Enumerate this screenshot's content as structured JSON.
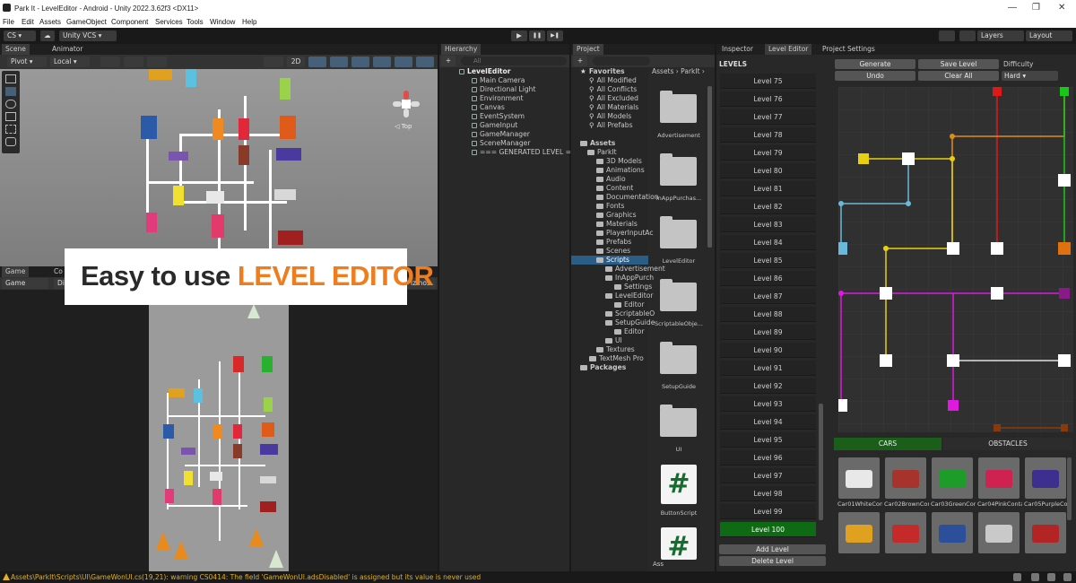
{
  "window": {
    "title": "Park It - LevelEditor - Android - Unity 2022.3.62f3 <DX11>",
    "min": "—",
    "max": "❐",
    "close": "✕"
  },
  "menu": [
    "File",
    "Edit",
    "Assets",
    "GameObject",
    "Component",
    "Services",
    "Tools",
    "Window",
    "Help"
  ],
  "toolbar": {
    "account": "CS ▾",
    "cloud": "☁",
    "vcs": "Unity VCS ▾",
    "play": "▶",
    "pause": "❚❚",
    "step": "▶❚",
    "layers": "Layers",
    "layout": "Layout"
  },
  "scene": {
    "tab_scene": "Scene",
    "tab_animator": "Animator",
    "pivot": "Pivot ▾",
    "local": "Local ▾",
    "mode2d": "2D",
    "axis_label": "◁ Top"
  },
  "game": {
    "tab_game": "Game",
    "tab_console_partial": "Co",
    "display_label": "Game",
    "display_partial": "Di",
    "gizmos_partial": "izmos"
  },
  "overlay": {
    "text_a": "Easy to use ",
    "text_b": "LEVEL EDITOR"
  },
  "hierarchy": {
    "tab": "Hierarchy",
    "search_placeholder": "All",
    "items": [
      "LevelEditor",
      "Main Camera",
      "Directional Light",
      "Environment",
      "Canvas",
      "EventSystem",
      "GameInput",
      "GameManager",
      "SceneManager",
      "=== GENERATED LEVEL ==="
    ]
  },
  "project": {
    "tab": "Project",
    "favorites_title": "Favorites",
    "favorites": [
      "All Modified",
      "All Conflicts",
      "All Excluded",
      "All Materials",
      "All Models",
      "All Prefabs"
    ],
    "assets_title": "Assets",
    "tree": [
      "ParkIt",
      "3D Models",
      "Animations",
      "Audio",
      "Content",
      "Documentation",
      "Fonts",
      "Graphics",
      "Materials",
      "PlayerInputAc",
      "Prefabs",
      "Scenes",
      "Scripts",
      "Advertisement",
      "InAppPurch",
      "Settings",
      "LevelEditor",
      "Editor",
      "ScriptableO",
      "SetupGuide",
      "Editor",
      "UI",
      "Textures",
      "TextMesh Pro",
      "Packages"
    ],
    "breadcrumb": "Assets › ParkIt ›",
    "grid_items": [
      "Advertisement",
      "InAppPurchas...",
      "LevelEditor",
      "ScriptableObje...",
      "SetupGuide",
      "UI",
      "ButtonScript"
    ],
    "bottom_partial": "Ass"
  },
  "inspector": {
    "tab_inspector": "Inspector",
    "tab_level_editor": "Level Editor",
    "tab_project_settings": "Project Settings"
  },
  "level_editor": {
    "levels_title": "LEVELS",
    "levels": [
      "Level 75",
      "Level 76",
      "Level 77",
      "Level 78",
      "Level 79",
      "Level 80",
      "Level 81",
      "Level 82",
      "Level 83",
      "Level 84",
      "Level 85",
      "Level 86",
      "Level 87",
      "Level 88",
      "Level 89",
      "Level 90",
      "Level 91",
      "Level 92",
      "Level 93",
      "Level 94",
      "Level 95",
      "Level 96",
      "Level 97",
      "Level 98",
      "Level 99",
      "Level 100"
    ],
    "selected_level": "Level 100",
    "add_level": "Add Level",
    "delete_level": "Delete Level",
    "generate": "Generate",
    "save_level": "Save Level",
    "difficulty_label": "Difficulty",
    "undo": "Undo",
    "clear_all": "Clear All",
    "difficulty_value": "Hard ▾",
    "tab_cars": "CARS",
    "tab_obstacles": "OBSTACLES",
    "cars": [
      {
        "name": "Car01WhiteCont",
        "color": "#e8e8e8"
      },
      {
        "name": "Car02BrownCor",
        "color": "#a8332c"
      },
      {
        "name": "Car03GreenCon",
        "color": "#1e9c2a"
      },
      {
        "name": "Car04PinkConta",
        "color": "#d02250"
      },
      {
        "name": "Car05PurpleCor",
        "color": "#3d2f8f"
      }
    ],
    "cars_row2_colors": [
      "#e0a020",
      "#c42a2a",
      "#2b4f9a",
      "#c9c9c9",
      "#b32525"
    ]
  },
  "status": {
    "warning": "Assets\\ParkIt\\Scripts\\UI\\GameWonUI.cs(19,21): warning CS0414: The field 'GameWonUI.adsDisabled' is assigned but its value is never used"
  }
}
